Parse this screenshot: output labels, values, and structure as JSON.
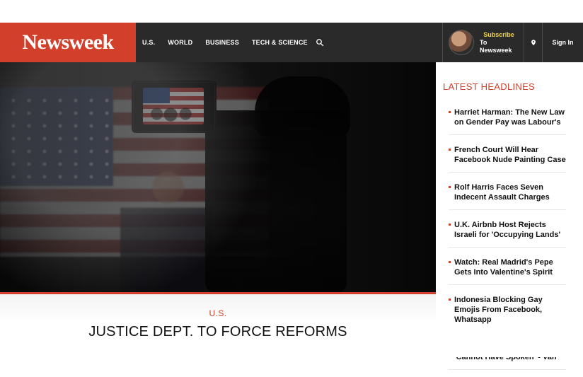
{
  "header": {
    "brand": "Newsweek",
    "nav": [
      "U.S.",
      "WORLD",
      "BUSINESS",
      "TECH & SCIENCE"
    ],
    "subscribe": {
      "top": "Subscribe",
      "bottom": "To Newsweek"
    },
    "signin": "Sign In"
  },
  "hero": {
    "category": "U.S.",
    "headline": "JUSTICE DEPT. TO FORCE REFORMS"
  },
  "sidebar": {
    "title": "LATEST HEADLINES",
    "items": [
      "Harriet Harman: The New Law on Gender Pay was Labour's",
      "French Court Will Hear Facebook Nude Painting Case",
      "Rolf Harris Faces Seven Indecent Assault Charges",
      "U.K. Airbnb Host Rejects Israeli for 'Occupying Lands'",
      "Watch: Real Madrid's Pepe Gets Into Valentine's Spirit",
      "Indonesia Blocking Gay Emojis From Facebook, Whatsapp",
      "Mourinho and Woodward 'Cannot Have Spoken' - Van"
    ]
  },
  "icons": {
    "search": "search-icon",
    "location": "location-pin-icon",
    "avatar": "avatar"
  },
  "colors": {
    "brand_red": "#d23f2b",
    "header_dark": "#2a2a2a",
    "subscribe_yellow": "#f1d24a"
  }
}
